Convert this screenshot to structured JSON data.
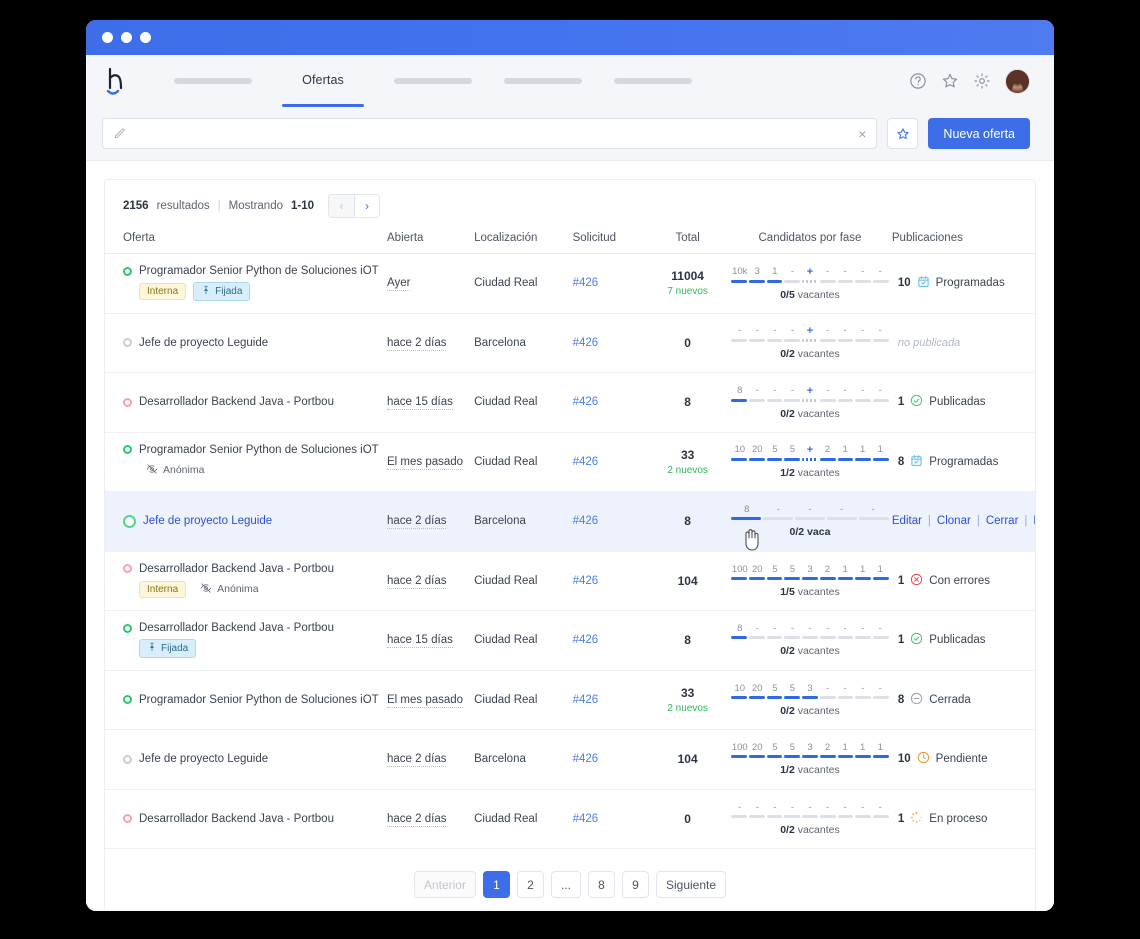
{
  "window": {
    "title": ""
  },
  "navbar": {
    "brand": "logo",
    "items": [
      {
        "type": "pill",
        "label": ""
      },
      {
        "type": "tab",
        "label": "Ofertas",
        "active": true
      },
      {
        "type": "pill",
        "label": ""
      },
      {
        "type": "pill",
        "label": ""
      },
      {
        "type": "pill",
        "label": ""
      }
    ],
    "icons": [
      "help-icon",
      "star-icon",
      "gear-icon",
      "avatar"
    ]
  },
  "search": {
    "value": "",
    "placeholder": "",
    "clear": "×",
    "favorite_icon": "star-icon",
    "new_offer_label": "Nueva oferta"
  },
  "results": {
    "count": "2156",
    "count_label": "resultados",
    "showing_label": "Mostrando",
    "showing_range": "1-10",
    "prev": "‹",
    "next": "›"
  },
  "table": {
    "headers": [
      "Oferta",
      "Abierta",
      "Localización",
      "Solicitud",
      "Total",
      "Candidatos por fase",
      "Publicaciones"
    ],
    "vacantes_label": "vacantes",
    "rows": [
      {
        "status": "green",
        "title": "Programador Senior Python de Soluciones iOT",
        "tags": [
          {
            "kind": "interna",
            "label": "Interna"
          },
          {
            "kind": "fijada",
            "label": "Fijada"
          }
        ],
        "abierta": "Ayer",
        "localizacion": "Ciudad Real",
        "solicitud": "#426",
        "total": "11004",
        "nuevos": "7 nuevos",
        "phase_nums": [
          "10k",
          "3",
          "1",
          "-",
          "+",
          "-",
          "-",
          "-",
          "-"
        ],
        "phase_fill": [
          "on",
          "on",
          "on",
          "off",
          "dots",
          "off",
          "off",
          "off",
          "off"
        ],
        "vacantes": "0/5",
        "pub_count": "10",
        "pub_status": "Programadas",
        "pub_icon": "calendar-check-icon"
      },
      {
        "status": "grey",
        "title": "Jefe de proyecto Leguide",
        "tags": [],
        "abierta": "hace 2 días",
        "localizacion": "Barcelona",
        "solicitud": "#426",
        "total": "0",
        "nuevos": "",
        "phase_nums": [
          "-",
          "-",
          "-",
          "-",
          "+",
          "-",
          "-",
          "-",
          "-"
        ],
        "phase_fill": [
          "off",
          "off",
          "off",
          "off",
          "dots",
          "off",
          "off",
          "off",
          "off"
        ],
        "vacantes": "0/2",
        "pub_count": "",
        "pub_status": "no publicada",
        "pub_icon": ""
      },
      {
        "status": "red",
        "title": "Desarrollador Backend Java - Portbou",
        "tags": [],
        "abierta": "hace 15 días",
        "localizacion": "Ciudad Real",
        "solicitud": "#426",
        "total": "8",
        "nuevos": "",
        "phase_nums": [
          "8",
          "-",
          "-",
          "-",
          "+",
          "-",
          "-",
          "-",
          "-"
        ],
        "phase_fill": [
          "on",
          "off",
          "off",
          "off",
          "dots",
          "off",
          "off",
          "off",
          "off"
        ],
        "vacantes": "0/2",
        "pub_count": "1",
        "pub_status": "Publicadas",
        "pub_icon": "check-circle-icon"
      },
      {
        "status": "green",
        "title": "Programador Senior Python de Soluciones iOT",
        "tags": [
          {
            "kind": "anon",
            "label": "Anónima"
          }
        ],
        "abierta": "El mes pasado",
        "localizacion": "Ciudad Real",
        "solicitud": "#426",
        "total": "33",
        "nuevos": "2 nuevos",
        "phase_nums": [
          "10",
          "20",
          "5",
          "5",
          "+",
          "2",
          "1",
          "1",
          "1"
        ],
        "phase_fill": [
          "on",
          "on",
          "on",
          "on",
          "dotson",
          "on",
          "on",
          "on",
          "on"
        ],
        "vacantes": "1/2",
        "pub_count": "8",
        "pub_status": "Programadas",
        "pub_icon": "calendar-check-icon"
      },
      {
        "status": "green-big",
        "hovered": true,
        "title": "Jefe de proyecto Leguide",
        "tags": [],
        "abierta": "hace 2 días",
        "localizacion": "Barcelona",
        "solicitud": "#426",
        "total": "8",
        "nuevos": "",
        "phase_nums": [
          "8",
          "-",
          "-",
          "-",
          "-"
        ],
        "phase_fill": [
          "on",
          "off",
          "off",
          "off",
          "off"
        ],
        "vacantes": "0/2 vaca",
        "vacantes_raw": true,
        "actions": [
          "Editar",
          "Clonar",
          "Cerrar",
          "Eliminar"
        ],
        "pub_count": "",
        "pub_status": "",
        "pub_icon": ""
      },
      {
        "status": "red",
        "title": "Desarrollador Backend Java - Portbou",
        "tags": [
          {
            "kind": "interna",
            "label": "Interna"
          },
          {
            "kind": "anon",
            "label": "Anónima"
          }
        ],
        "abierta": "hace 2 días",
        "localizacion": "Ciudad Real",
        "solicitud": "#426",
        "total": "104",
        "nuevos": "",
        "phase_nums": [
          "100",
          "20",
          "5",
          "5",
          "3",
          "2",
          "1",
          "1",
          "1"
        ],
        "phase_fill": [
          "on",
          "on",
          "on",
          "on",
          "on",
          "on",
          "on",
          "on",
          "on"
        ],
        "vacantes": "1/5",
        "pub_count": "1",
        "pub_status": "Con errores",
        "pub_icon": "error-circle-icon"
      },
      {
        "status": "green",
        "title": "Desarrollador Backend Java - Portbou",
        "tags": [
          {
            "kind": "fijada",
            "label": "Fijada"
          }
        ],
        "abierta": "hace 15 días",
        "localizacion": "Ciudad Real",
        "solicitud": "#426",
        "total": "8",
        "nuevos": "",
        "phase_nums": [
          "8",
          "-",
          "-",
          "-",
          "-",
          "-",
          "-",
          "-",
          "-"
        ],
        "phase_fill": [
          "on",
          "off",
          "off",
          "off",
          "off",
          "off",
          "off",
          "off",
          "off"
        ],
        "vacantes": "0/2",
        "pub_count": "1",
        "pub_status": "Publicadas",
        "pub_icon": "check-circle-icon"
      },
      {
        "status": "green",
        "title": "Programador Senior Python de Soluciones iOT",
        "tags": [],
        "abierta": "El mes pasado",
        "localizacion": "Ciudad Real",
        "solicitud": "#426",
        "total": "33",
        "nuevos": "2 nuevos",
        "phase_nums": [
          "10",
          "20",
          "5",
          "5",
          "3",
          "-",
          "-",
          "-",
          "-"
        ],
        "phase_fill": [
          "on",
          "on",
          "on",
          "on",
          "on",
          "off",
          "off",
          "off",
          "off"
        ],
        "vacantes": "0/2",
        "pub_count": "8",
        "pub_status": "Cerrada",
        "pub_icon": "minus-circle-icon"
      },
      {
        "status": "grey",
        "title": "Jefe de proyecto Leguide",
        "tags": [],
        "abierta": "hace 2 días",
        "localizacion": "Barcelona",
        "solicitud": "#426",
        "total": "104",
        "nuevos": "",
        "phase_nums": [
          "100",
          "20",
          "5",
          "5",
          "3",
          "2",
          "1",
          "1",
          "1"
        ],
        "phase_fill": [
          "on",
          "on",
          "on",
          "on",
          "on",
          "on",
          "on",
          "on",
          "on"
        ],
        "vacantes": "1/2",
        "pub_count": "10",
        "pub_status": "Pendiente",
        "pub_icon": "clock-icon"
      },
      {
        "status": "red",
        "title": "Desarrollador Backend Java - Portbou",
        "tags": [],
        "abierta": "hace 2 días",
        "localizacion": "Ciudad Real",
        "solicitud": "#426",
        "total": "0",
        "nuevos": "",
        "phase_nums": [
          "-",
          "-",
          "-",
          "-",
          "-",
          "-",
          "-",
          "-",
          "-"
        ],
        "phase_fill": [
          "off",
          "off",
          "off",
          "off",
          "off",
          "off",
          "off",
          "off",
          "off"
        ],
        "vacantes": "0/2",
        "pub_count": "1",
        "pub_status": "En proceso",
        "pub_icon": "spinner-icon"
      }
    ]
  },
  "pagination": {
    "prev": "Anterior",
    "pages": [
      "1",
      "2",
      "...",
      "8",
      "9"
    ],
    "active": "1",
    "next": "Siguiente"
  },
  "colors": {
    "brand_blue": "#3d6ee8",
    "link_blue": "#2b4fd0",
    "green": "#28c76f",
    "red": "#fb9fae",
    "error_red": "#e8434f",
    "orange": "#f0922b",
    "hover_row": "#edf2fd"
  }
}
